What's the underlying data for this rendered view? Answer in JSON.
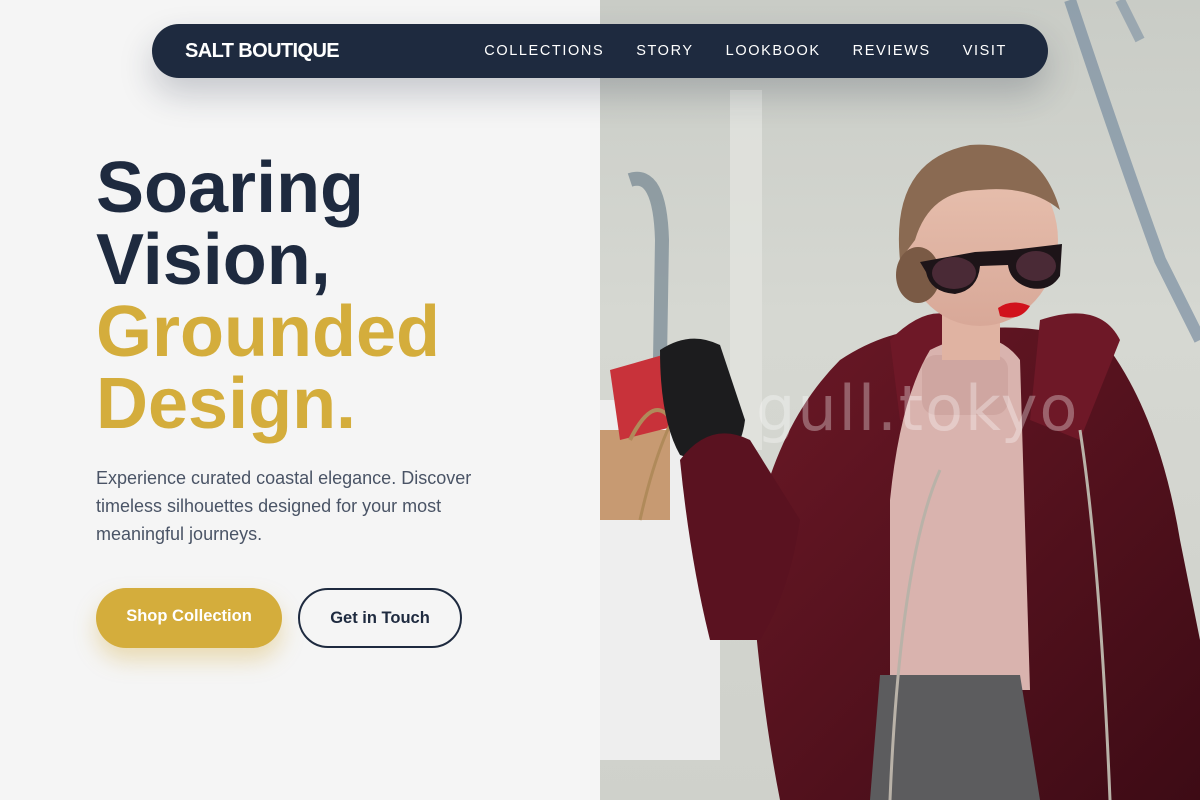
{
  "brand": {
    "name": "SALT BOUTIQUE"
  },
  "nav": {
    "items": [
      {
        "label": "COLLECTIONS"
      },
      {
        "label": "STORY"
      },
      {
        "label": "LOOKBOOK"
      },
      {
        "label": "REVIEWS"
      },
      {
        "label": "VISIT"
      }
    ]
  },
  "hero": {
    "headline_line1": "Soaring",
    "headline_line2": "Vision,",
    "headline_line3": "Grounded",
    "headline_line4": "Design.",
    "description": "Experience curated coastal elegance. Discover timeless silhouettes designed for your most meaningful journeys.",
    "primary_cta": "Shop Collection",
    "secondary_cta": "Get in Touch"
  },
  "image": {
    "watermark": "gull.tokyo",
    "icon": "fashion-photo"
  },
  "colors": {
    "navy": "#1e2a3f",
    "gold": "#d4ad3c",
    "background": "#f5f5f5",
    "body_text": "#4a5466"
  }
}
